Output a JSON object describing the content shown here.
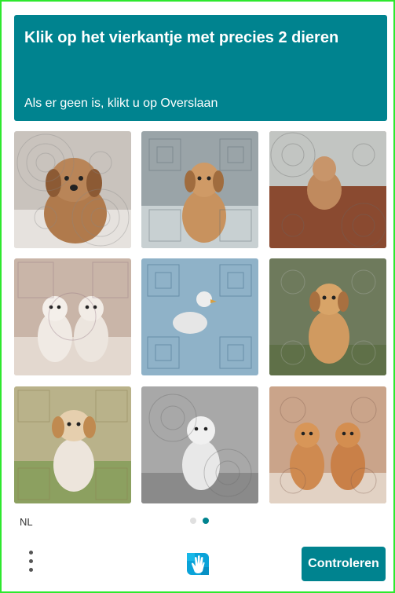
{
  "header": {
    "title": "Klik op het vierkantje met precies 2 dieren",
    "subtitle": "Als er geen is, klikt u op Overslaan"
  },
  "tiles": [
    {
      "subject": "one puppy on a bed",
      "bg": "#c9c3bd"
    },
    {
      "subject": "one puppy sitting",
      "bg": "#9aa4a8"
    },
    {
      "subject": "one puppy on porch",
      "bg": "#a88a78"
    },
    {
      "subject": "two puppies",
      "bg": "#c9b5a8"
    },
    {
      "subject": "bird on blue background",
      "bg": "#8fb2c8"
    },
    {
      "subject": "one puppy on grass",
      "bg": "#6e7a5c"
    },
    {
      "subject": "one puppy outdoors",
      "bg": "#b9b28a"
    },
    {
      "subject": "one white puppy",
      "bg": "#a8a8a8"
    },
    {
      "subject": "two puppies",
      "bg": "#caa48a"
    }
  ],
  "footer": {
    "language": "NL",
    "submit_label": "Controleren",
    "page_indicator": {
      "current": 2,
      "total": 2
    }
  },
  "colors": {
    "accent": "#00838f",
    "frame": "#2ee82e"
  },
  "icons": {
    "menu": "more-vertical-icon",
    "logo": "hcaptcha-hand-icon"
  }
}
